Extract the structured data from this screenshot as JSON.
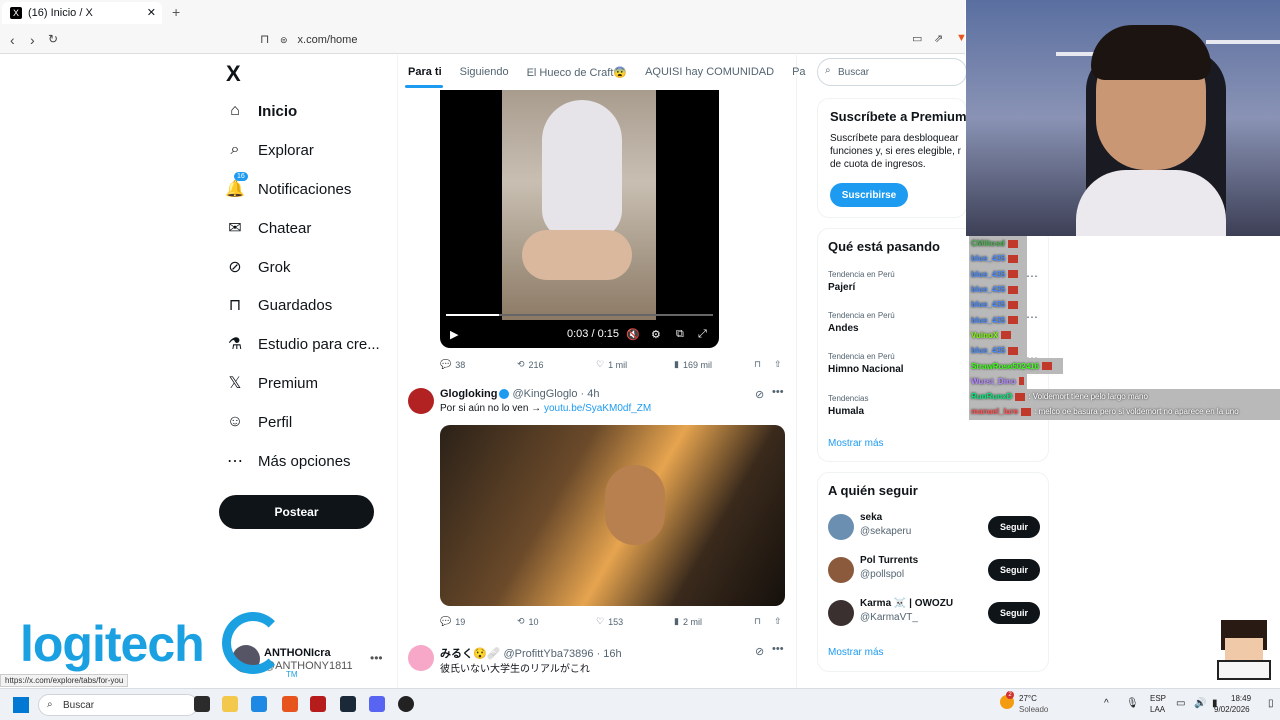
{
  "browser": {
    "tab_title": "(16) Inicio / X",
    "url": "x.com/home",
    "status_url": "https://x.com/explore/tabs/for-you"
  },
  "nav": {
    "logo": "X",
    "items": [
      {
        "label": "Inicio",
        "icon": "home-icon"
      },
      {
        "label": "Explorar",
        "icon": "search-icon"
      },
      {
        "label": "Notificaciones",
        "icon": "bell-icon",
        "badge": "16"
      },
      {
        "label": "Chatear",
        "icon": "mail-icon"
      },
      {
        "label": "Grok",
        "icon": "grok-icon"
      },
      {
        "label": "Guardados",
        "icon": "bookmark-icon"
      },
      {
        "label": "Estudio para cre...",
        "icon": "flask-icon"
      },
      {
        "label": "Premium",
        "icon": "x-icon"
      },
      {
        "label": "Perfil",
        "icon": "person-icon"
      },
      {
        "label": "Más opciones",
        "icon": "more-icon"
      }
    ],
    "post_label": "Postear",
    "account_name": "ANTHONIcra",
    "account_handle": "@ANTHONY1811"
  },
  "feed": {
    "tabs": [
      "Para ti",
      "Siguiendo",
      "El Hueco de Craft😨",
      "AQUISI hay COMUNIDAD",
      "Pa"
    ],
    "video1": {
      "time": "0:03 / 0:15",
      "progress": 0.2
    },
    "tweet1_actions": {
      "replies": "38",
      "reposts": "216",
      "likes": "1 mil",
      "views": "169 mil"
    },
    "tweet2": {
      "name": "Glogloking",
      "handle": "@KingGloglo · 4h",
      "text": "Por si aún no lo ven → ",
      "link": "youtu.be/SyaKM0df_ZM"
    },
    "tweet2_actions": {
      "replies": "19",
      "reposts": "10",
      "likes": "153",
      "views": "2 mil"
    },
    "tweet3": {
      "name": "みるく😯🩹",
      "handle": "@ProfittYba73896 · 16h",
      "text": "彼氏いない大学生のリアルがこれ"
    }
  },
  "sidebar": {
    "search_placeholder": "Buscar",
    "premium": {
      "title": "Suscríbete a Premium",
      "text": "Suscríbete para desbloquear funciones y, si eres elegible, r de cuota de ingresos.",
      "button": "Suscribirse"
    },
    "trends_title": "Qué está pasando",
    "trends": [
      {
        "category": "Tendencia en Perú",
        "name": "Pajerí"
      },
      {
        "category": "Tendencia en Perú",
        "name": "Andes"
      },
      {
        "category": "Tendencia en Perú",
        "name": "Himno Nacional"
      },
      {
        "category": "Tendencias",
        "name": "Humala"
      }
    ],
    "show_more": "Mostrar más",
    "follow_title": "A quién seguir",
    "follow": [
      {
        "name": "seka",
        "handle": "@sekaperu",
        "button": "Seguir"
      },
      {
        "name": "Pol Turrents",
        "handle": "@pollspol",
        "button": "Seguir"
      },
      {
        "name": "Karma ☠️ | OWOZU",
        "handle": "@KarmaVT_",
        "button": "Seguir"
      }
    ],
    "follow_more": "Mostrar más"
  },
  "chat": [
    {
      "user": "CMiltosd",
      "msg": ""
    },
    {
      "user": "blue_435",
      "msg": ""
    },
    {
      "user": "blue_435",
      "msg": ""
    },
    {
      "user": "blue_435",
      "msg": ""
    },
    {
      "user": "blue_435",
      "msg": ""
    },
    {
      "user": "blue_435",
      "msg": ""
    },
    {
      "user": "VulnoX",
      "msg": ""
    },
    {
      "user": "blue_435",
      "msg": ""
    },
    {
      "user": "StrawRose502416",
      "msg": ""
    },
    {
      "user": "Wurst_Dino",
      "msg": ""
    },
    {
      "user": "RunRunxD",
      "msg": ": Voldemort tiene pelo largo mano"
    },
    {
      "user": "manuel_lure",
      "msg": ": melco oe basura pero si voldemort no aparece en la uno"
    }
  ],
  "overlay": {
    "brand": "logitech",
    "tm": "TM"
  },
  "taskbar": {
    "search": "Buscar",
    "weather_temp": "27°C",
    "weather_text": "Soleado",
    "lang1": "ESP",
    "lang2": "LAA",
    "time": "18:49",
    "date": "9/02/2026",
    "weather_badge": "2"
  }
}
